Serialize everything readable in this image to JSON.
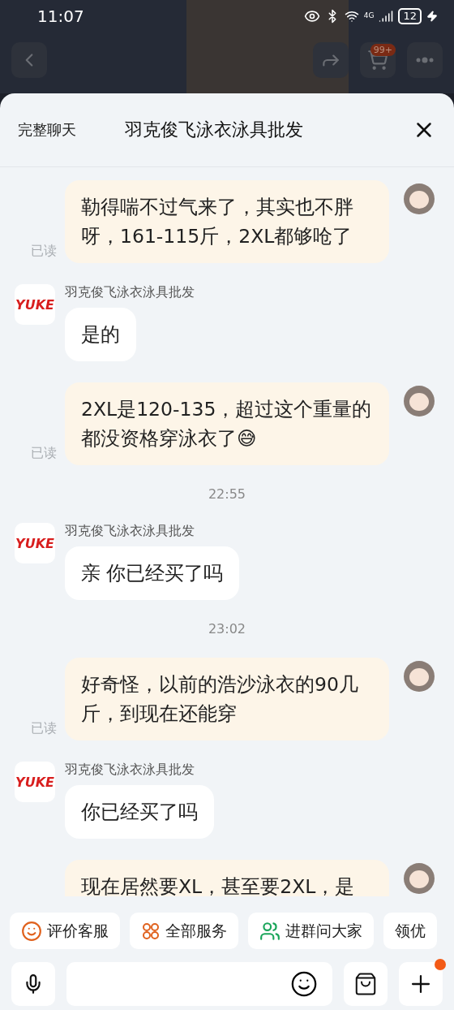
{
  "status_bar": {
    "time": "11:07",
    "network": "4G",
    "battery": "12"
  },
  "backdrop": {
    "cart_badge": "99+"
  },
  "chat": {
    "left_action": "完整聊天",
    "title": "羽克俊飞泳衣泳具批发"
  },
  "messages": [
    {
      "kind": "sent",
      "text": "勒得喘不过气来了，其实也不胖呀，161-115斤，2XL都够呛了",
      "status": "已读"
    },
    {
      "kind": "received",
      "logo": "YUKE",
      "sender": "羽克俊飞泳衣泳具批发",
      "text": "是的"
    },
    {
      "kind": "sent",
      "text": "2XL是120-135，超过这个重量的都没资格穿泳衣了😅",
      "status": "已读"
    },
    {
      "kind": "time",
      "text": "22:55"
    },
    {
      "kind": "received",
      "logo": "YUKE",
      "sender": "羽克俊飞泳衣泳具批发",
      "text": "亲 你已经买了吗"
    },
    {
      "kind": "time",
      "text": "23:02"
    },
    {
      "kind": "sent",
      "text": "好奇怪，以前的浩沙泳衣的90几斤，到现在还能穿",
      "status": "已读"
    },
    {
      "kind": "received",
      "logo": "YUKE",
      "sender": "羽克俊飞泳衣泳具批发",
      "text": "你已经买了吗"
    },
    {
      "kind": "sent",
      "text": "现在居然要XL，甚至要2XL，是"
    }
  ],
  "quick_actions": [
    {
      "kind": "rate",
      "label": "评价客服",
      "color": "#e0621e"
    },
    {
      "kind": "services",
      "label": "全部服务",
      "color": "#e0621e"
    },
    {
      "kind": "group",
      "label": "进群问大家",
      "color": "#1aa55a"
    },
    {
      "kind": "plain",
      "label": "领优"
    }
  ],
  "input_bar": {
    "plus_badge": true
  }
}
